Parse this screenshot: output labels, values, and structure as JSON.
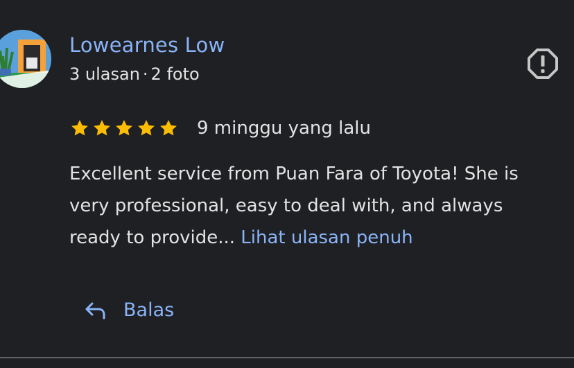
{
  "review": {
    "author_name": "Lowearnes Low",
    "author_meta_reviews": "3 ulasan",
    "author_meta_separator": "·",
    "author_meta_photos": "2 foto",
    "rating": 5,
    "rating_max": 5,
    "time_ago": "9 minggu yang lalu",
    "text_line1": "Excellent service from Puan Fara of Toyota! She is",
    "text_line2": "very professional, easy to deal with, and always",
    "text_line3": "ready to provide... ",
    "read_more_label": "Lihat ulasan penuh",
    "reply_label": "Balas",
    "report_icon": "report-flag-icon"
  },
  "colors": {
    "background": "#1f2023",
    "accent": "#8ab4f8",
    "text": "#e3e3e3",
    "star": "#fbbc04",
    "icon": "#c4c7c5",
    "divider": "#5f6368"
  }
}
